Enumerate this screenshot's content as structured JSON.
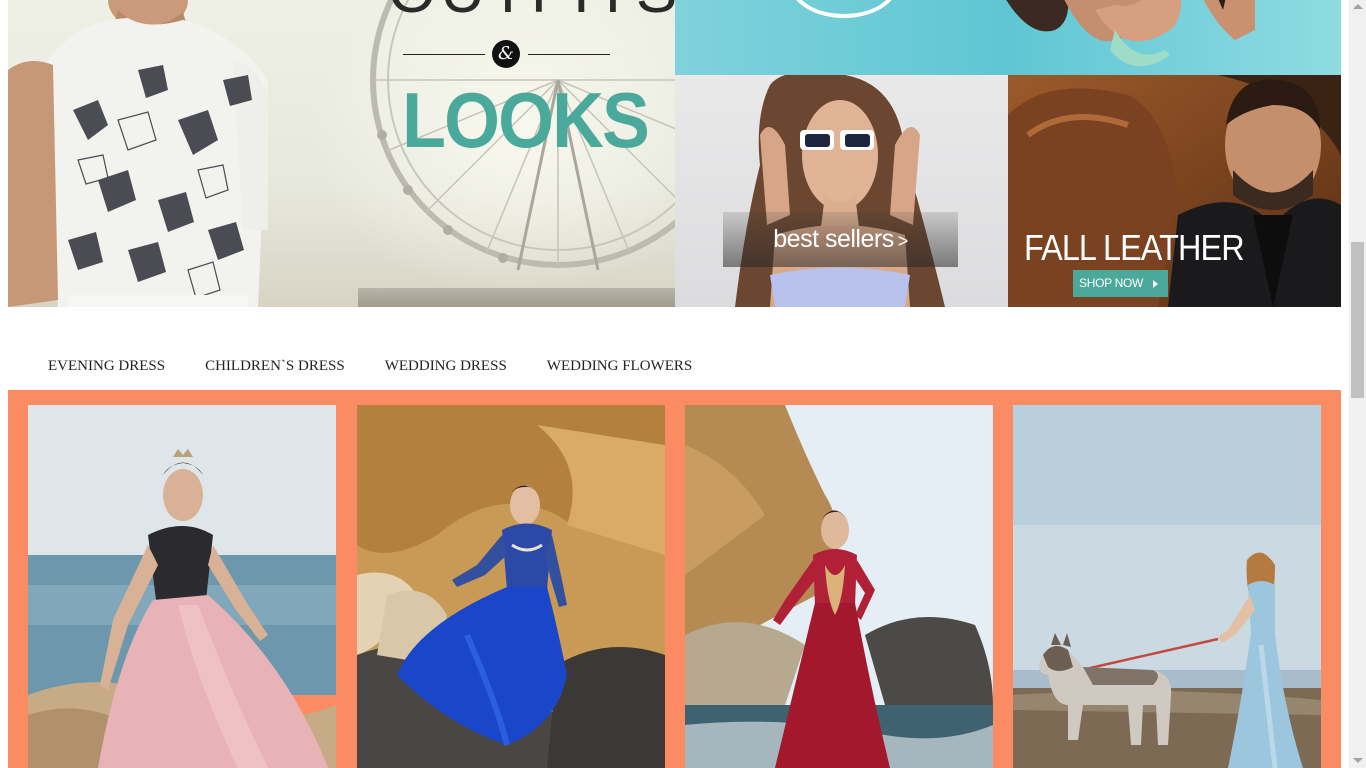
{
  "hero": {
    "outfits_text": "OUTFITS",
    "ampersand": "&",
    "looks_text": "LOOKS"
  },
  "tiles": {
    "best_sellers": {
      "label": "best sellers",
      "arrow": ">"
    },
    "fall_leather": {
      "title": "FALL LEATHER",
      "button_label": "SHOP NOW"
    }
  },
  "categories": [
    {
      "label": "EVENING DRESS"
    },
    {
      "label": "CHILDREN`S DRESS"
    },
    {
      "label": "WEDDING DRESS"
    },
    {
      "label": "WEDDING FLOWERS"
    }
  ],
  "products": [
    {
      "name": "product-pink-gown",
      "dress_color": "#e8b3b6",
      "scene": "sea"
    },
    {
      "name": "product-blue-gown",
      "dress_color": "#1a47c9",
      "scene": "rocks"
    },
    {
      "name": "product-red-gown",
      "dress_color": "#a3182c",
      "scene": "rocks-sea"
    },
    {
      "name": "product-lightblue-gown",
      "dress_color": "#9cc6dd",
      "scene": "beach-dog"
    }
  ],
  "colors": {
    "accent_teal": "#4aa99a",
    "panel_orange": "#fa8b62",
    "sky_blue": "#5fc6d3"
  }
}
